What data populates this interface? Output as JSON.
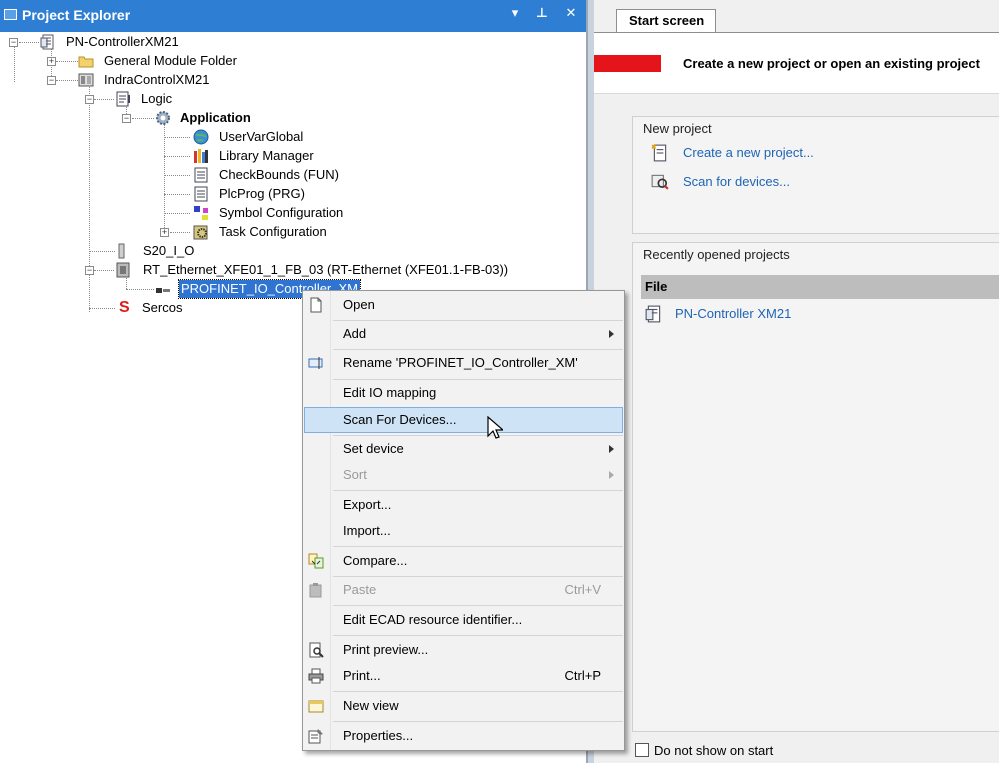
{
  "explorer": {
    "title": "Project Explorer",
    "buttons": [
      "▾",
      "⊥",
      "✕"
    ]
  },
  "tree": {
    "root": "PN-ControllerXM21",
    "general_module_folder": "General Module Folder",
    "indra": "IndraControlXM21",
    "logic": "Logic",
    "application": "Application",
    "uservar": "UserVarGlobal",
    "library": "Library Manager",
    "checkbounds": "CheckBounds (FUN)",
    "plcprog": "PlcProg (PRG)",
    "symbol": "Symbol Configuration",
    "task": "Task Configuration",
    "s20": "S20_I_O",
    "rt_ethernet": "RT_Ethernet_XFE01_1_FB_03 (RT-Ethernet (XFE01.1-FB-03))",
    "profinet": "PROFINET_IO_Controller_XM",
    "sercos": "Sercos"
  },
  "context_menu": {
    "items": [
      {
        "label": "Open"
      },
      {
        "label": "Add"
      },
      {
        "label": "Rename 'PROFINET_IO_Controller_XM'"
      },
      {
        "label": "Edit IO mapping"
      },
      {
        "label": "Scan For Devices..."
      },
      {
        "label": "Set device"
      },
      {
        "label": "Sort"
      },
      {
        "label": "Export..."
      },
      {
        "label": "Import..."
      },
      {
        "label": "Compare..."
      },
      {
        "label": "Paste",
        "shortcut": "Ctrl+V"
      },
      {
        "label": "Edit ECAD resource identifier..."
      },
      {
        "label": "Print preview..."
      },
      {
        "label": "Print...",
        "shortcut": "Ctrl+P"
      },
      {
        "label": "New view"
      },
      {
        "label": "Properties..."
      }
    ]
  },
  "start_screen": {
    "tab": "Start screen",
    "headline": "Create a new project or open an existing project",
    "new_project": {
      "title": "New project",
      "create": "Create a new project...",
      "scan": "Scan for devices..."
    },
    "recent": {
      "title": "Recently opened projects",
      "file_header": "File",
      "items": [
        "PN-Controller XM21"
      ]
    },
    "do_not_show": "Do not show on start"
  },
  "colors": {
    "header_blue": "#2e7fd3",
    "selection_blue": "#2f74d0",
    "link_blue": "#1e64b4",
    "accent_red": "#e5141a",
    "menu_highlight": "#cfe3f6"
  }
}
